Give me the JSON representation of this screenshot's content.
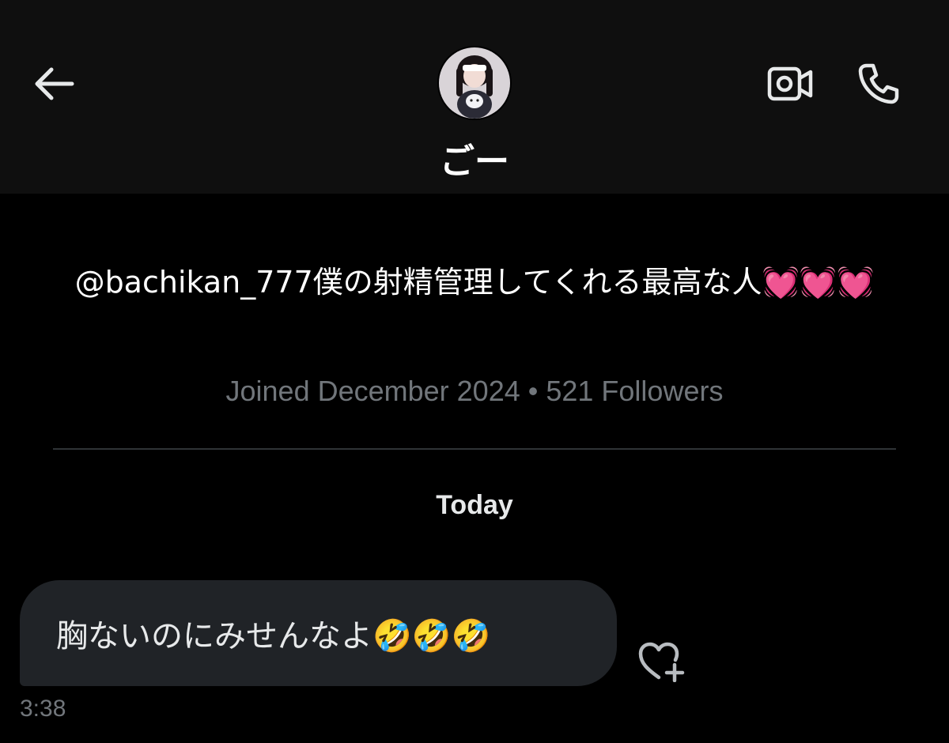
{
  "header": {
    "contact_name": "ごー",
    "avatar_icon": "profile-avatar",
    "back_icon": "arrow-left-icon",
    "video_call_icon": "video-camera-icon",
    "voice_call_icon": "phone-icon"
  },
  "profile": {
    "bio": "@bachikan_777僕の射精管理してくれる最高な人💓💓💓",
    "meta": "Joined December 2024 • 521 Followers"
  },
  "conversation": {
    "date_separator": "Today",
    "messages": [
      {
        "text": "胸ないのにみせんなよ🤣🤣🤣",
        "time": "3:38",
        "react_icon": "heart-plus-icon"
      }
    ]
  },
  "colors": {
    "background": "#000000",
    "header_bg": "#0f0f0f",
    "bubble_bg": "#202327",
    "muted_text": "#71767b",
    "primary_text": "#e7e9ea"
  }
}
